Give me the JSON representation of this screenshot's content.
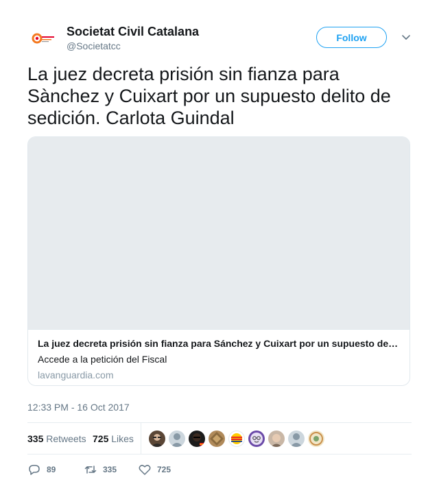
{
  "account": {
    "name": "Societat Civil Catalana",
    "handle": "@Societatcc",
    "avatar_icon": "scc-logo-icon"
  },
  "follow_label": "Follow",
  "tweet": {
    "text": "La juez decreta prisión sin fianza para Sànchez y Cuixart por un supuesto delito de sedición. Carlota Guindal",
    "timestamp": "12:33 PM - 16 Oct 2017"
  },
  "card": {
    "title": "La juez decreta prisión sin fianza para Sánchez y Cuixart por un supuesto delito de sedición",
    "description": "Accede a la petición del Fiscal",
    "domain": "lavanguardia.com"
  },
  "stats": {
    "retweets_count": "335",
    "retweets_label": "Retweets",
    "likes_count": "725",
    "likes_label": "Likes"
  },
  "actions": {
    "reply_count": "89",
    "retweet_count": "335",
    "like_count": "725"
  },
  "colors": {
    "accent": "#1da1f2",
    "muted": "#657786"
  }
}
